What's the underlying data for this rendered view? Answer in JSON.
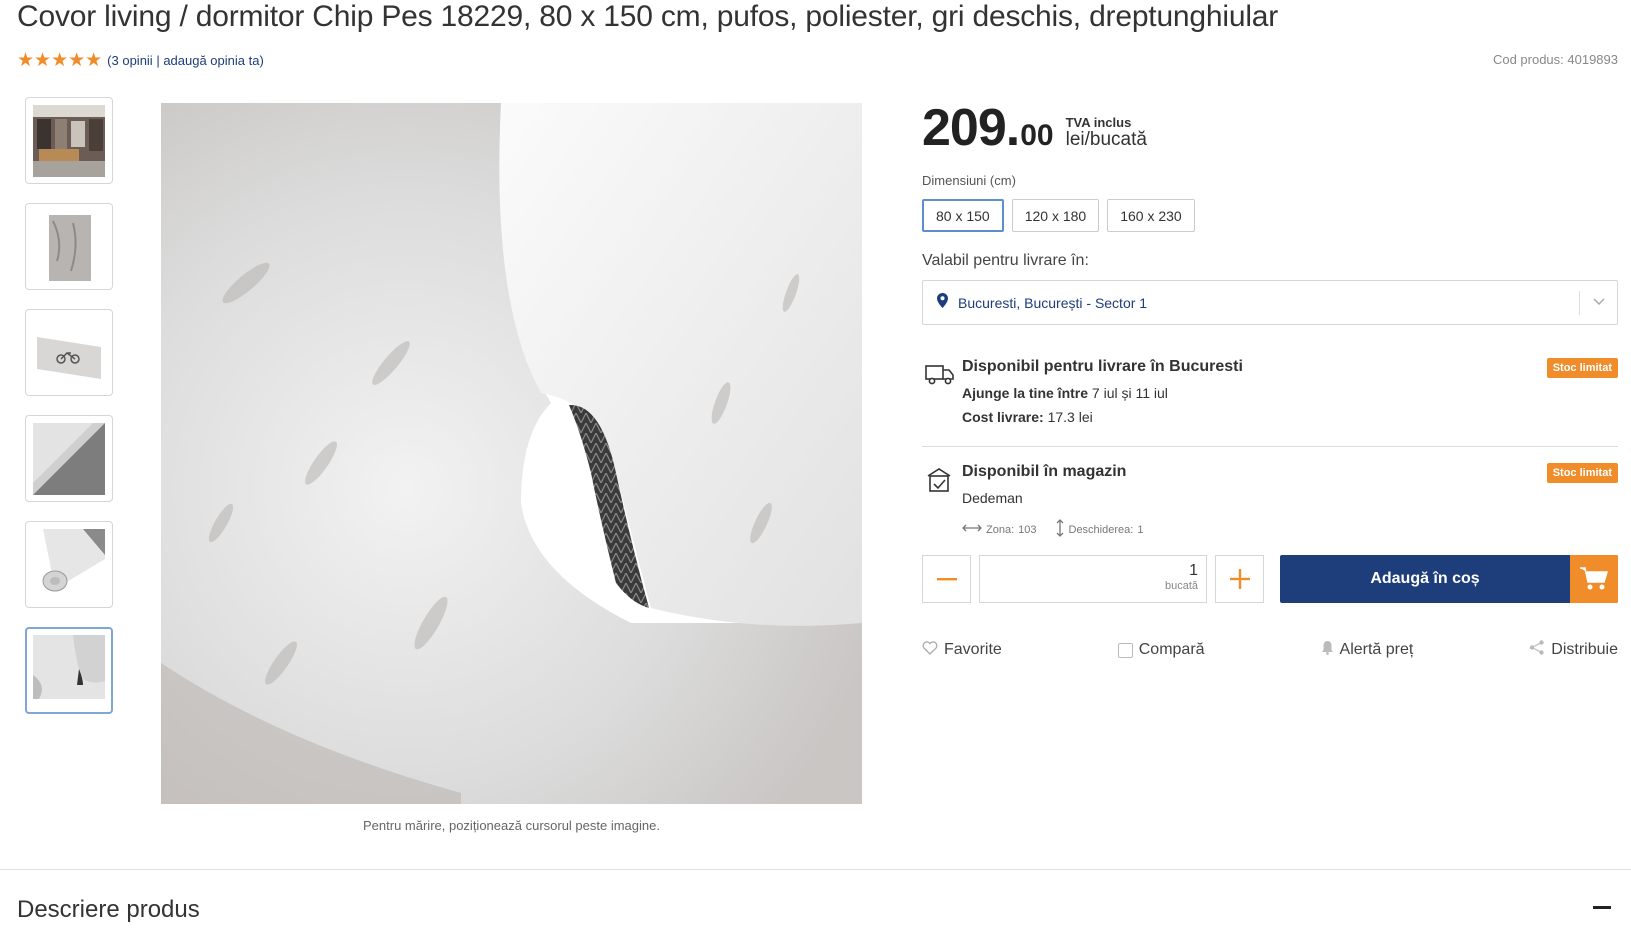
{
  "product": {
    "title": "Covor living / dormitor Chip Pes 18229, 80 x 150 cm, pufos, poliester, gri deschis, dreptunghiular",
    "stars": "★★★★★",
    "rating_value": 5,
    "opinions_link": "(3 opinii",
    "add_opinion_link": "| adaugă opinia ta)",
    "product_code": "Cod produs: 4019893"
  },
  "gallery": {
    "thumbnails": [
      "living-room-photo",
      "rug-top-view",
      "rug-with-bike-motif",
      "rug-corner-detail",
      "rug-rolled",
      "rug-folded-closeup"
    ],
    "active_index": 5,
    "zoom_hint": "Pentru mărire, poziționează cursorul peste imagine."
  },
  "price": {
    "integer": "209.",
    "decimals": "00",
    "tva": "TVA inclus",
    "unit": "lei/bucată"
  },
  "dimensions": {
    "label": "Dimensiuni (cm)",
    "options": [
      "80 x 150",
      "120 x 180",
      "160 x 230"
    ],
    "selected": "80 x 150"
  },
  "delivery": {
    "label": "Valabil pentru livrare în:",
    "location": "Bucuresti, București - Sector 1"
  },
  "availability": {
    "delivery": {
      "title": "Disponibil pentru livrare în Bucuresti",
      "arrives_label": "Ajunge la tine între",
      "arrives_value": "7 iul și 11 iul",
      "cost_label": "Cost livrare:",
      "cost_value": "17.3 lei",
      "badge": "Stoc limitat"
    },
    "store": {
      "title": "Disponibil în magazin",
      "store_name": "Dedeman",
      "zone_label": "Zona:",
      "zone_value": "103",
      "opening_label": "Deschiderea:",
      "opening_value": "1",
      "badge": "Stoc limitat"
    }
  },
  "cart": {
    "quantity": "1",
    "quantity_unit": "bucată",
    "add_label": "Adaugă în coș"
  },
  "actions": {
    "favorite": "Favorite",
    "compare": "Compară",
    "price_alert": "Alertă preț",
    "share": "Distribuie"
  },
  "description": {
    "title": "Descriere produs"
  },
  "colors": {
    "brand_blue": "#1e3d7b",
    "accent_orange": "#f08c2a"
  }
}
